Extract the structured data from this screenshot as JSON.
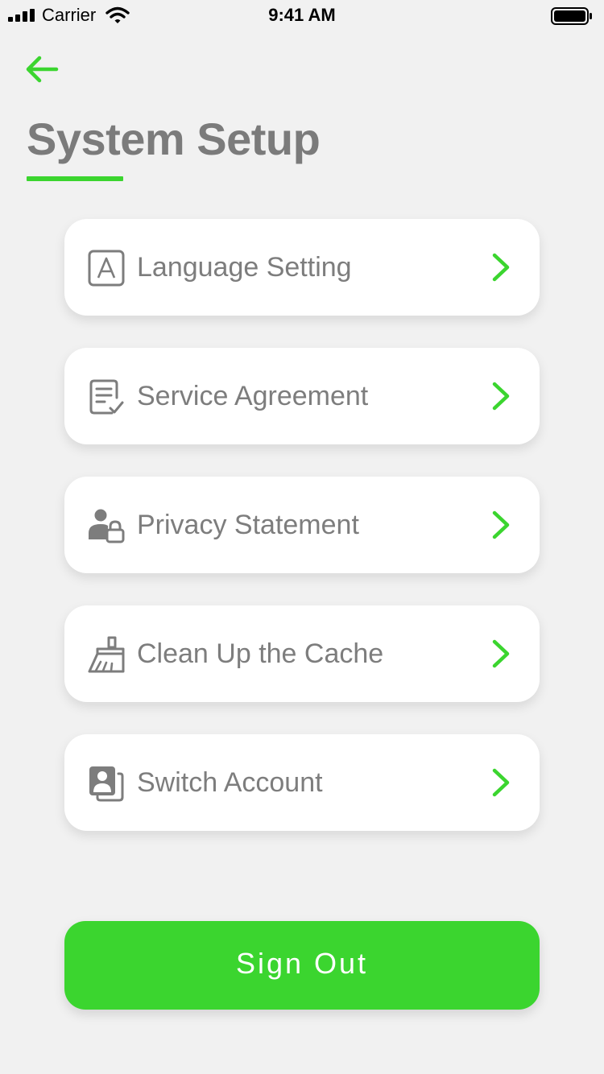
{
  "status_bar": {
    "carrier": "Carrier",
    "time": "9:41 AM",
    "signal_icon": "signal-bars-icon",
    "wifi_icon": "wifi-icon",
    "battery_icon": "battery-icon"
  },
  "header": {
    "back_icon": "arrow-left-icon",
    "title": "System Setup"
  },
  "menu": {
    "items": [
      {
        "label": "Language Setting",
        "icon": "language-icon"
      },
      {
        "label": "Service Agreement",
        "icon": "document-check-icon"
      },
      {
        "label": "Privacy Statement",
        "icon": "user-lock-icon"
      },
      {
        "label": "Clean Up the Cache",
        "icon": "broom-icon"
      },
      {
        "label": "Switch Account",
        "icon": "account-switch-icon"
      }
    ],
    "chevron_icon": "chevron-right-icon"
  },
  "actions": {
    "sign_out_label": "Sign Out"
  },
  "colors": {
    "accent": "#3bd52f",
    "background": "#f1f1f1",
    "text": "#7d7d7d",
    "card": "#ffffff"
  }
}
